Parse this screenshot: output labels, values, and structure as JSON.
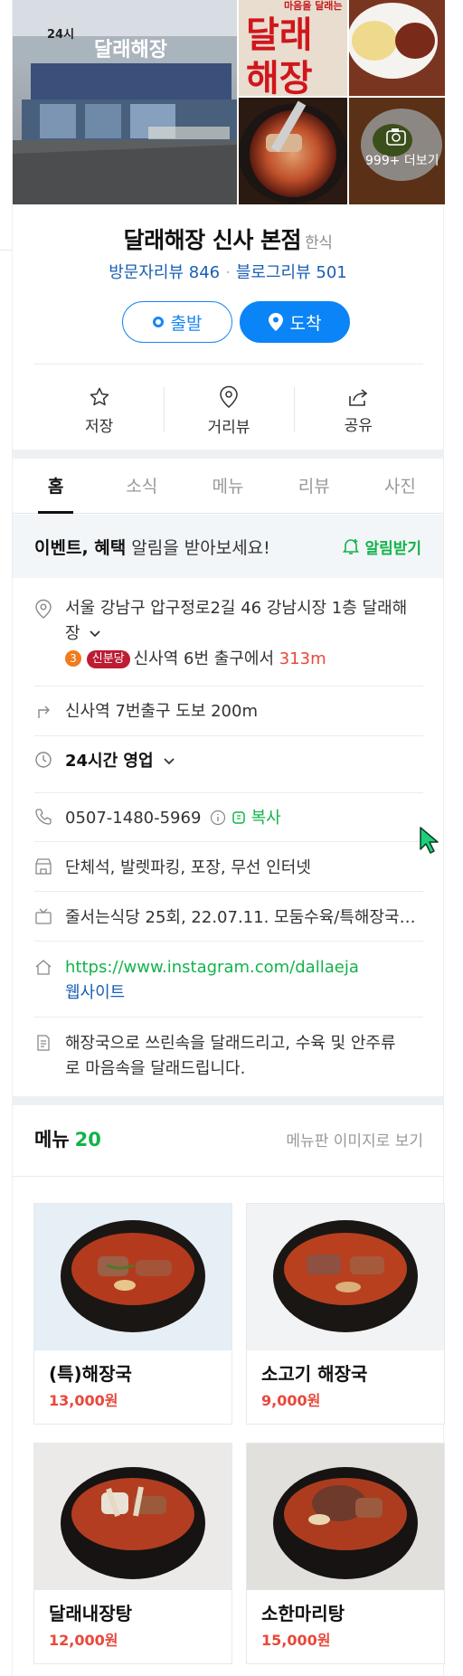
{
  "photos": {
    "storefront_sign": "달래해장",
    "hours_sign": "24시",
    "poster_top": "마음을 달래는",
    "poster_main_1": "달래",
    "poster_main_2": "해장",
    "more_label": "999+ 더보기"
  },
  "place": {
    "name": "달래해장 신사 본점",
    "category": "한식",
    "visitor_review": "방문자리뷰 846",
    "blog_review": "블로그리뷰 501"
  },
  "buttons": {
    "start": "출발",
    "arrive": "도착"
  },
  "actions": [
    {
      "label": "저장",
      "icon": "star-icon"
    },
    {
      "label": "거리뷰",
      "icon": "map-pin-icon"
    },
    {
      "label": "공유",
      "icon": "share-icon"
    }
  ],
  "tabs": [
    "홈",
    "소식",
    "메뉴",
    "리뷰",
    "사진"
  ],
  "alert": {
    "bold": "이벤트, 혜택",
    "rest": " 알림을 받아보세요!",
    "button": "알림받기"
  },
  "info": {
    "address_line1": "서울 강남구 압구정로2길 46 강남시장 1층 달래해",
    "address_line2": "장",
    "subway_num": "3",
    "subway_line": "신분당",
    "subway_text": "신사역 6번 출구에서",
    "subway_dist": "313m",
    "directions": "신사역 7번출구 도보 200m",
    "hours": "24시간 영업",
    "phone": "0507-1480-5969",
    "copy": "복사",
    "amenities": "단체석, 발렛파킹, 포장, 무선 인터넷",
    "tv": "줄서는식당 25회, 22.07.11. 모둠수육/특해장국…",
    "instagram": "https://www.instagram.com/dallaeja",
    "website": "웹사이트",
    "description_line1": "해장국으로 쓰린속을 달래드리고, 수육 및 안주류",
    "description_line2": "로 마음속을 달래드립니다."
  },
  "menu": {
    "title": "메뉴",
    "count": "20",
    "view_image": "메뉴판 이미지로 보기",
    "items": [
      {
        "name": "(특)해장국",
        "price": "13,000원"
      },
      {
        "name": "소고기 해장국",
        "price": "9,000원"
      },
      {
        "name": "달래내장탕",
        "price": "12,000원"
      },
      {
        "name": "소한마리탕",
        "price": "15,000원"
      }
    ]
  },
  "colors": {
    "primary": "#0a84f6",
    "green": "#12b34a",
    "price": "#e8483a"
  }
}
